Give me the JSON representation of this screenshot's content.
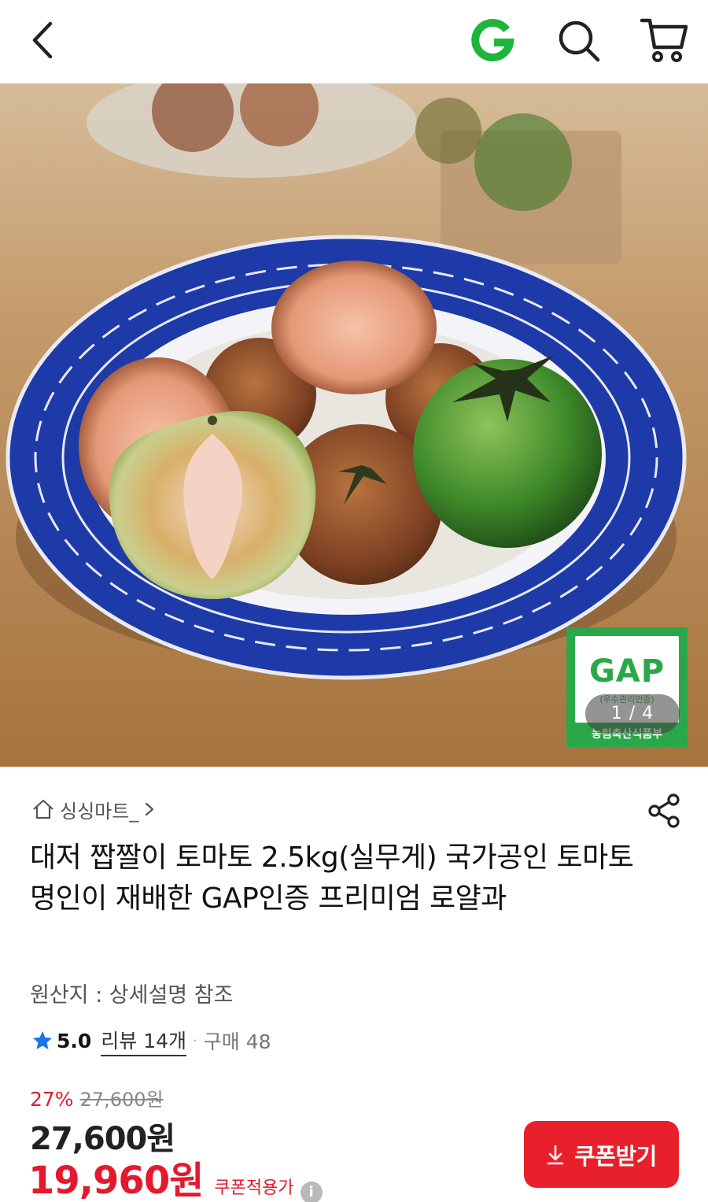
{
  "header": {
    "back_icon": "chevron-left-icon",
    "logo_letter": "G",
    "logo_color": "#1fb53a",
    "search_icon": "search-icon",
    "cart_icon": "cart-icon"
  },
  "gallery": {
    "badge_text": "GAP",
    "badge_sub": "(우수관리인증)",
    "badge_foot": "농림축산식품부",
    "badge_color": "#2aa849",
    "pager": "1 / 4"
  },
  "seller": {
    "name": "싱싱마트_"
  },
  "product": {
    "title": "대저 짭짤이 토마토 2.5kg(실무게) 국가공인 토마토 명인이 재배한 GAP인증 프리미엄 로얄과",
    "origin": "원산지 : 상세설명 참조",
    "rating": "5.0",
    "reviews": "리뷰 14개",
    "sold": "구매 48"
  },
  "price": {
    "discount_rate": "27%",
    "original": "27,600원",
    "sale": "27,600원",
    "coupon_price": "19,960원",
    "coupon_label": "쿠폰적용가",
    "accent_color": "#e5192e"
  },
  "coupon_button": {
    "label": "쿠폰받기",
    "color": "#e8202b"
  }
}
